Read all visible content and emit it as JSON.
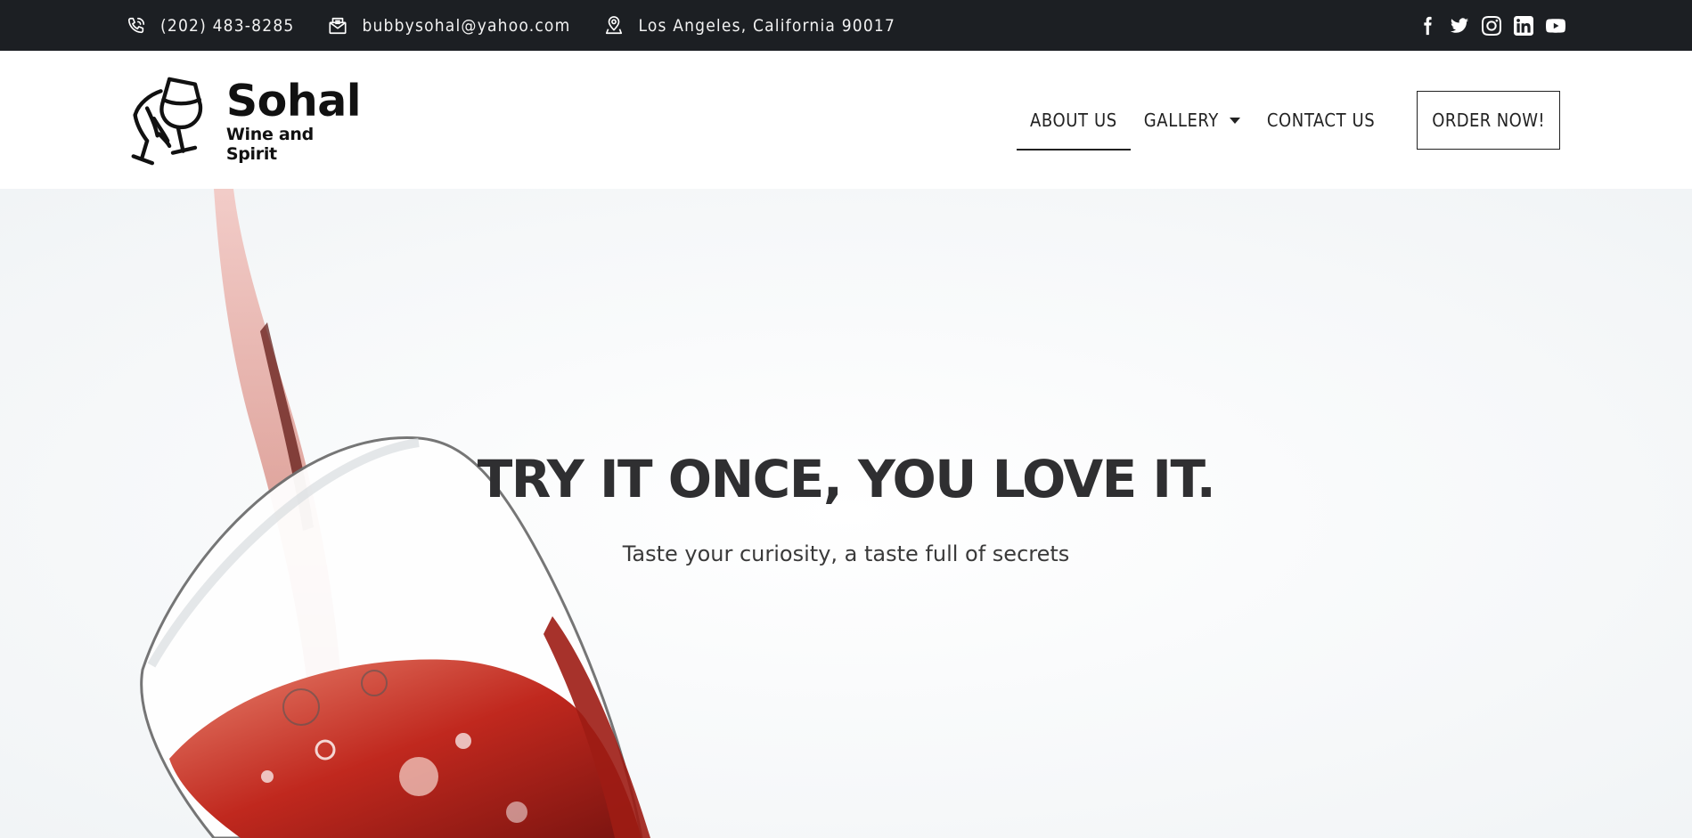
{
  "topbar": {
    "phone": "(202) 483-8285",
    "email": "bubbysohal@yahoo.com",
    "address": "Los Angeles, California 90017",
    "contact_icons": [
      "phone-icon",
      "envelope-icon",
      "location-pin-icon"
    ],
    "social_icons": [
      "facebook-icon",
      "twitter-icon",
      "instagram-icon",
      "linkedin-icon",
      "youtube-icon"
    ]
  },
  "header": {
    "logo": {
      "name": "Sohal",
      "tagline": "Wine and Spirit",
      "icon": "wine-glass-hand-icon"
    },
    "nav": {
      "about": "ABOUT US",
      "gallery": "GALLERY",
      "contact": "CONTACT US",
      "active": "ABOUT US"
    },
    "order_button": "ORDER NOW!"
  },
  "hero": {
    "title": "TRY IT ONCE, YOU LOVE IT.",
    "subtitle": "Taste your curiosity, a taste full of secrets",
    "image": "red wine pouring into glass"
  },
  "colors": {
    "topbar_bg": "#1c1f23",
    "text_dark": "#2f2f31",
    "wine_red": "#c0281e"
  }
}
